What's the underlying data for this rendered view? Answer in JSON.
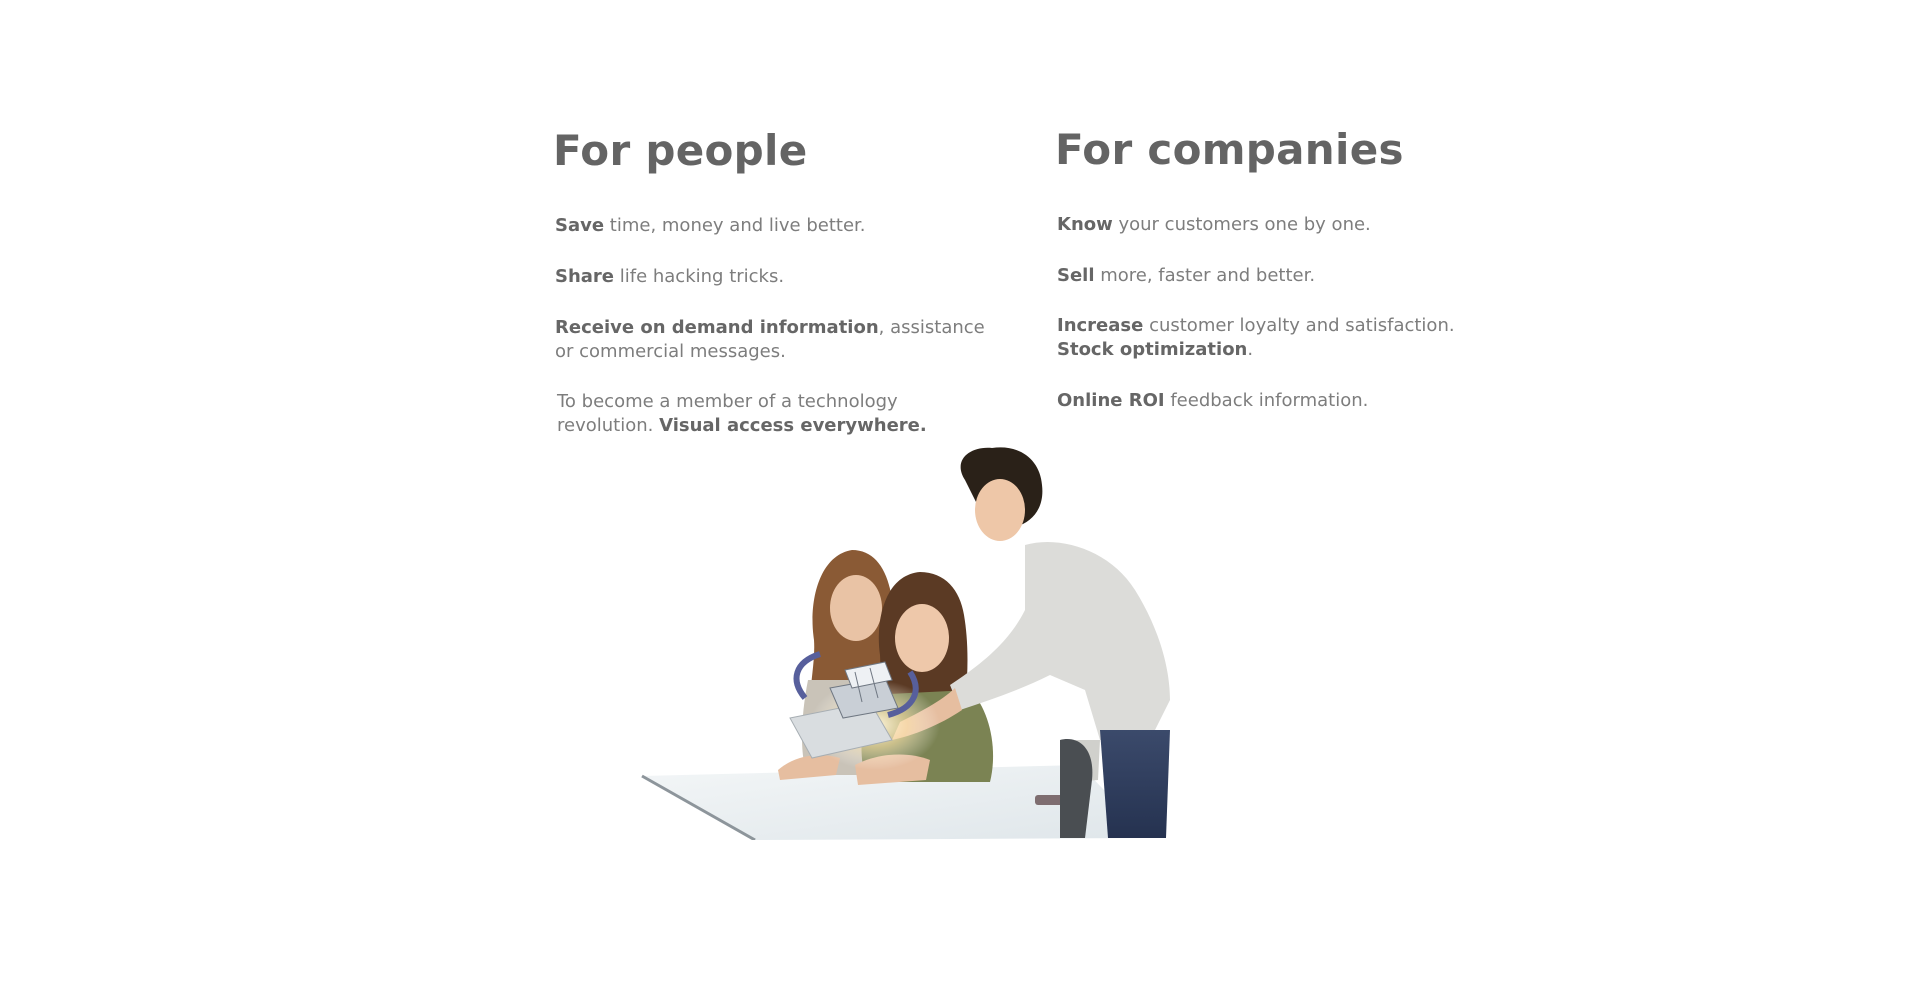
{
  "people": {
    "heading": "For people",
    "items": [
      {
        "bold": "Save",
        "text": " time, money and live better.",
        "bold2": "",
        "text2": ""
      },
      {
        "bold": "Share",
        "text": " life hacking tricks.",
        "bold2": "",
        "text2": ""
      },
      {
        "bold": "Receive on demand information",
        "text": ", assistance",
        "bold2": "",
        "text2": "or commercial messages."
      },
      {
        "bold": "",
        "text": "To become a member of a technology",
        "text_line2": "revolution. ",
        "bold2": "Visual access everywhere."
      }
    ]
  },
  "companies": {
    "heading": "For companies",
    "items": [
      {
        "bold": "Know",
        "text": " your customers one by one."
      },
      {
        "bold": "Sell",
        "text": " more, faster and better."
      },
      {
        "bold": "Increase",
        "text": " customer loyalty and satisfaction."
      },
      {
        "bold": "Stock optimization",
        "text": "."
      },
      {
        "bold": "Online ROI",
        "text": " feedback information."
      }
    ]
  },
  "illustration": {
    "description_icon": "people-with-tablet-hologram-illustration"
  },
  "colors": {
    "heading": "#646464",
    "body_text": "#7d7d7d",
    "bold_text": "#666666",
    "background": "#ffffff"
  }
}
